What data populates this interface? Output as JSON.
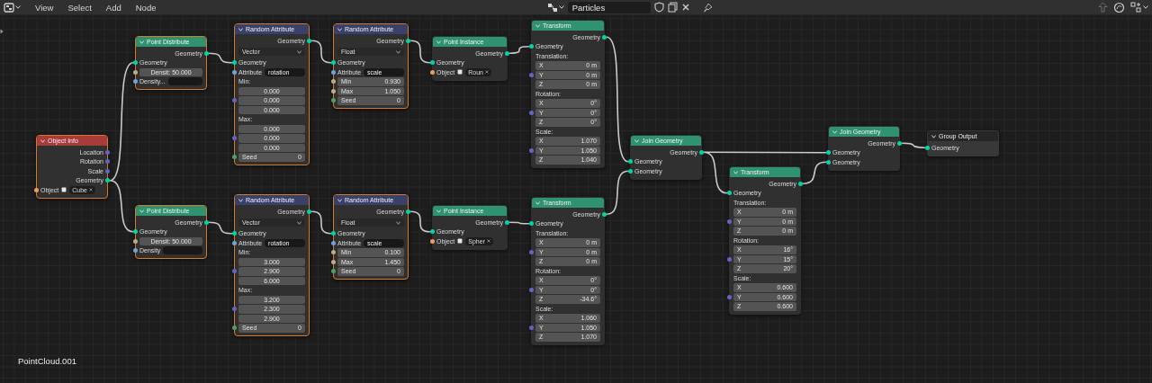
{
  "header": {
    "menus": [
      "View",
      "Select",
      "Add",
      "Node"
    ],
    "tree_name": "Particles"
  },
  "nodes": [
    {
      "title": "Object Info",
      "kind": "input",
      "selected": true,
      "rows": [
        {
          "kind": "output",
          "label": "Location",
          "color": "#6363c7"
        },
        {
          "kind": "output",
          "label": "Rotation",
          "color": "#6363c7"
        },
        {
          "kind": "output",
          "label": "Scale",
          "color": "#6363c7"
        },
        {
          "kind": "output",
          "label": "Geometry",
          "color": "#00d6a3"
        },
        {
          "kind": "object",
          "label": "Object",
          "value": "Cube",
          "color": "#ed9e5c"
        }
      ]
    },
    {
      "title": "Point Distribute",
      "kind": "geometry",
      "selected": true,
      "rows": [
        {
          "kind": "output",
          "label": "Geometry",
          "color": "#00d6a3"
        },
        {
          "kind": "input",
          "label": "Geometry",
          "color": "#00d6a3"
        },
        {
          "kind": "value",
          "value": "Densit: 50.000",
          "color": "#bdaa88"
        },
        {
          "kind": "attribute",
          "label": "Density...",
          "color": "#6ea4d8"
        }
      ]
    },
    {
      "title": "Random Attribute",
      "kind": "attribute",
      "selected": true,
      "rows": [
        {
          "kind": "output",
          "label": "Geometry",
          "color": "#00d6a3"
        },
        {
          "kind": "dropdown",
          "value": "Vector"
        },
        {
          "kind": "input",
          "label": "Geometry",
          "color": "#00d6a3"
        },
        {
          "kind": "attribute",
          "label": "Attribute",
          "value": "rotation",
          "color": "#6ea4d8"
        },
        {
          "kind": "section",
          "label": "Min:"
        },
        {
          "kind": "field",
          "value": "0.000"
        },
        {
          "kind": "field",
          "value": "0.000",
          "color": "#6363c7"
        },
        {
          "kind": "field",
          "value": "0.000"
        },
        {
          "kind": "section",
          "label": "Max:"
        },
        {
          "kind": "field",
          "value": "0.000"
        },
        {
          "kind": "field",
          "value": "0.000",
          "color": "#6363c7"
        },
        {
          "kind": "field",
          "value": "0.000"
        },
        {
          "kind": "field",
          "label": "Seed",
          "value": "0",
          "color": "#4fa063"
        }
      ]
    },
    {
      "title": "Random Attribute",
      "kind": "attribute",
      "selected": true,
      "rows": [
        {
          "kind": "output",
          "label": "Geometry",
          "color": "#00d6a3"
        },
        {
          "kind": "dropdown",
          "value": "Float"
        },
        {
          "kind": "input",
          "label": "Geometry",
          "color": "#00d6a3"
        },
        {
          "kind": "attribute",
          "label": "Attribute",
          "value": "scale",
          "color": "#6ea4d8"
        },
        {
          "kind": "field",
          "label": "Min",
          "value": "0.930",
          "color": "#bdaa88"
        },
        {
          "kind": "field",
          "label": "Max",
          "value": "1.050",
          "color": "#bdaa88"
        },
        {
          "kind": "field",
          "label": "Seed",
          "value": "0",
          "color": "#4fa063"
        }
      ]
    },
    {
      "title": "Point Instance",
      "kind": "geometry",
      "selected": false,
      "rows": [
        {
          "kind": "output",
          "label": "Geometry",
          "color": "#00d6a3"
        },
        {
          "kind": "input",
          "label": "Geometry",
          "color": "#00d6a3"
        },
        {
          "kind": "object",
          "label": "Object",
          "value": "Roun",
          "color": "#ed9e5c"
        }
      ]
    },
    {
      "title": "Transform",
      "kind": "geometry",
      "selected": false,
      "rows": [
        {
          "kind": "output",
          "label": "Geometry",
          "color": "#00d6a3"
        },
        {
          "kind": "input",
          "label": "Geometry",
          "color": "#00d6a3"
        },
        {
          "kind": "section",
          "label": "Translation:"
        },
        {
          "kind": "field",
          "label": "X",
          "value": "0 m"
        },
        {
          "kind": "field",
          "label": "Y",
          "value": "0 m",
          "color": "#6363c7"
        },
        {
          "kind": "field",
          "label": "Z",
          "value": "0 m"
        },
        {
          "kind": "section",
          "label": "Rotation:"
        },
        {
          "kind": "field",
          "label": "X",
          "value": "0°"
        },
        {
          "kind": "field",
          "label": "Y",
          "value": "0°",
          "color": "#6363c7"
        },
        {
          "kind": "field",
          "label": "Z",
          "value": "0°"
        },
        {
          "kind": "section",
          "label": "Scale:"
        },
        {
          "kind": "field",
          "label": "X",
          "value": "1.070"
        },
        {
          "kind": "field",
          "label": "Y",
          "value": "1.050",
          "color": "#6363c7"
        },
        {
          "kind": "field",
          "label": "Z",
          "value": "1.040"
        }
      ]
    },
    {
      "title": "Join Geometry",
      "kind": "geometry",
      "selected": false,
      "rows": [
        {
          "kind": "output",
          "label": "Geometry",
          "color": "#00d6a3"
        },
        {
          "kind": "input",
          "label": "Geometry",
          "color": "#00d6a3"
        },
        {
          "kind": "input",
          "label": "Geometry",
          "color": "#00d6a3"
        }
      ]
    },
    {
      "title": "Transform",
      "kind": "geometry",
      "selected": false,
      "rows": [
        {
          "kind": "output",
          "label": "Geometry",
          "color": "#00d6a3"
        },
        {
          "kind": "input",
          "label": "Geometry",
          "color": "#00d6a3"
        },
        {
          "kind": "section",
          "label": "Translation:"
        },
        {
          "kind": "field",
          "label": "X",
          "value": "0 m"
        },
        {
          "kind": "field",
          "label": "Y",
          "value": "0 m",
          "color": "#6363c7"
        },
        {
          "kind": "field",
          "label": "Z",
          "value": "0 m"
        },
        {
          "kind": "section",
          "label": "Rotation:"
        },
        {
          "kind": "field",
          "label": "X",
          "value": "16°"
        },
        {
          "kind": "field",
          "label": "Y",
          "value": "15°",
          "color": "#6363c7"
        },
        {
          "kind": "field",
          "label": "Z",
          "value": "20°"
        },
        {
          "kind": "section",
          "label": "Scale:"
        },
        {
          "kind": "field",
          "label": "X",
          "value": "0.600"
        },
        {
          "kind": "field",
          "label": "Y",
          "value": "0.600",
          "color": "#6363c7"
        },
        {
          "kind": "field",
          "label": "Z",
          "value": "0.600"
        }
      ]
    },
    {
      "title": "Join Geometry",
      "kind": "geometry",
      "selected": false,
      "rows": [
        {
          "kind": "output",
          "label": "Geometry",
          "color": "#00d6a3"
        },
        {
          "kind": "input",
          "label": "Geometry",
          "color": "#00d6a3"
        },
        {
          "kind": "input",
          "label": "Geometry",
          "color": "#00d6a3"
        }
      ]
    },
    {
      "title": "Group Output",
      "kind": "output",
      "selected": false,
      "rows": [
        {
          "kind": "input",
          "label": "Geometry",
          "color": "#00d6a3"
        }
      ]
    },
    {
      "title": "Point Distribute",
      "kind": "geometry",
      "selected": true,
      "rows": [
        {
          "kind": "output",
          "label": "Geometry",
          "color": "#00d6a3"
        },
        {
          "kind": "input",
          "label": "Geometry",
          "color": "#00d6a3"
        },
        {
          "kind": "value",
          "value": "Densit: 50.000",
          "color": "#bdaa88"
        },
        {
          "kind": "attribute",
          "label": "Density",
          "color": "#6ea4d8"
        }
      ]
    },
    {
      "title": "Random Attribute",
      "kind": "attribute",
      "selected": true,
      "rows": [
        {
          "kind": "output",
          "label": "Geometry",
          "color": "#00d6a3"
        },
        {
          "kind": "dropdown",
          "value": "Vector"
        },
        {
          "kind": "input",
          "label": "Geometry",
          "color": "#00d6a3"
        },
        {
          "kind": "attribute",
          "label": "Attribute",
          "value": "rotation",
          "color": "#6ea4d8"
        },
        {
          "kind": "section",
          "label": "Min:"
        },
        {
          "kind": "field",
          "value": "3.000"
        },
        {
          "kind": "field",
          "value": "2.900",
          "color": "#6363c7"
        },
        {
          "kind": "field",
          "value": "6.000"
        },
        {
          "kind": "section",
          "label": "Max:"
        },
        {
          "kind": "field",
          "value": "3.200"
        },
        {
          "kind": "field",
          "value": "2.300",
          "color": "#6363c7"
        },
        {
          "kind": "field",
          "value": "2.900"
        },
        {
          "kind": "field",
          "label": "Seed",
          "value": "0",
          "color": "#4fa063"
        }
      ]
    },
    {
      "title": "Random Attribute",
      "kind": "attribute",
      "selected": true,
      "rows": [
        {
          "kind": "output",
          "label": "Geometry",
          "color": "#00d6a3"
        },
        {
          "kind": "dropdown",
          "value": "Float"
        },
        {
          "kind": "input",
          "label": "Geometry",
          "color": "#00d6a3"
        },
        {
          "kind": "attribute",
          "label": "Attribute",
          "value": "scale",
          "color": "#6ea4d8"
        },
        {
          "kind": "field",
          "label": "Min",
          "value": "0.100",
          "color": "#bdaa88"
        },
        {
          "kind": "field",
          "label": "Max",
          "value": "1.450",
          "color": "#bdaa88"
        },
        {
          "kind": "field",
          "label": "Seed",
          "value": "0",
          "color": "#4fa063"
        }
      ]
    },
    {
      "title": "Point Instance",
      "kind": "geometry",
      "selected": false,
      "rows": [
        {
          "kind": "output",
          "label": "Geometry",
          "color": "#00d6a3"
        },
        {
          "kind": "input",
          "label": "Geometry",
          "color": "#00d6a3"
        },
        {
          "kind": "object",
          "label": "Object",
          "value": "Spher",
          "color": "#ed9e5c"
        }
      ]
    },
    {
      "title": "Transform",
      "kind": "geometry",
      "selected": false,
      "rows": [
        {
          "kind": "output",
          "label": "Geometry",
          "color": "#00d6a3"
        },
        {
          "kind": "input",
          "label": "Geometry",
          "color": "#00d6a3"
        },
        {
          "kind": "section",
          "label": "Translation:"
        },
        {
          "kind": "field",
          "label": "X",
          "value": "0 m"
        },
        {
          "kind": "field",
          "label": "Y",
          "value": "0 m",
          "color": "#6363c7"
        },
        {
          "kind": "field",
          "label": "Z",
          "value": "0 m"
        },
        {
          "kind": "section",
          "label": "Rotation:"
        },
        {
          "kind": "field",
          "label": "X",
          "value": "0°"
        },
        {
          "kind": "field",
          "label": "Y",
          "value": "0°",
          "color": "#6363c7"
        },
        {
          "kind": "field",
          "label": "Z",
          "value": "-34.6°"
        },
        {
          "kind": "section",
          "label": "Scale:"
        },
        {
          "kind": "field",
          "label": "X",
          "value": "1.060"
        },
        {
          "kind": "field",
          "label": "Y",
          "value": "1.050",
          "color": "#6363c7"
        },
        {
          "kind": "field",
          "label": "Z",
          "value": "1.070"
        }
      ]
    }
  ],
  "object_name": "PointCloud.001"
}
